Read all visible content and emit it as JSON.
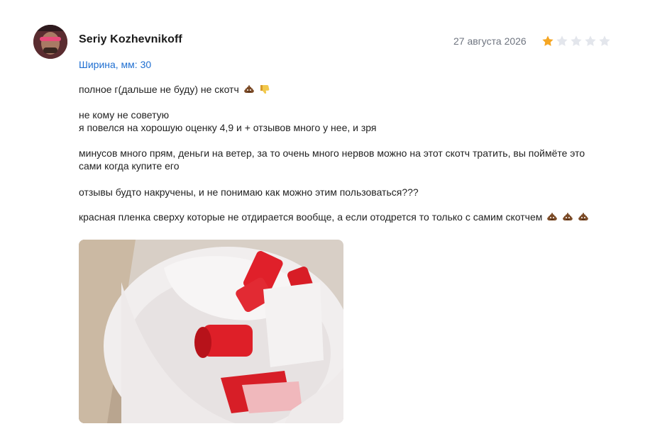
{
  "review": {
    "author": "Seriy Kozhevnikoff",
    "date": "27 августа 2026",
    "rating": 1,
    "rating_max": 5,
    "variant": "Ширина, мм: 30",
    "paragraphs": [
      "полное г(дальше не буду) не скотч",
      "не кому не советую",
      "я повелся на хорошую оценку 4,9 и + отзывов много у нее, и зря",
      "минусов много прям, деньги на ветер, за то очень много нервов можно на этот скотч тратить, вы поймёте это",
      "сами когда купите его",
      "отзывы будто накручены, и не понимаю как можно этим пользоваться???",
      "красная пленка сверху которые не отдирается вообще, а если отодрется то только с самим скотчем"
    ],
    "emojis": [
      "pile-of-poo-icon",
      "thumbs-down-icon"
    ],
    "colors": {
      "star_filled": "#f5a623",
      "star_empty": "#e3e6ec",
      "variant": "#1f6fd1",
      "date": "#6f7580"
    }
  }
}
